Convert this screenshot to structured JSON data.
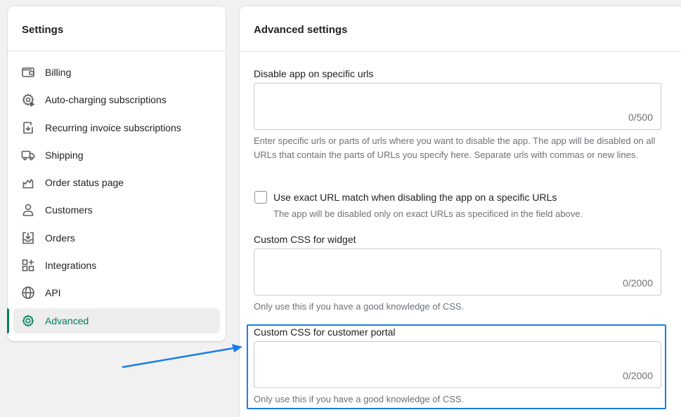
{
  "sidebar": {
    "title": "Settings",
    "items": [
      {
        "label": "Billing",
        "icon": "wallet-icon"
      },
      {
        "label": "Auto-charging subscriptions",
        "icon": "gear-play-icon"
      },
      {
        "label": "Recurring invoice subscriptions",
        "icon": "invoice-icon"
      },
      {
        "label": "Shipping",
        "icon": "truck-icon"
      },
      {
        "label": "Order status page",
        "icon": "order-status-icon"
      },
      {
        "label": "Customers",
        "icon": "person-icon"
      },
      {
        "label": "Orders",
        "icon": "inbox-download-icon"
      },
      {
        "label": "Integrations",
        "icon": "apps-icon"
      },
      {
        "label": "API",
        "icon": "globe-icon"
      },
      {
        "label": "Advanced",
        "icon": "gear-icon",
        "active": true
      }
    ]
  },
  "main": {
    "title": "Advanced settings",
    "disable_urls": {
      "label": "Disable app on specific urls",
      "value": "",
      "counter": "0/500",
      "help": "Enter specific urls or parts of urls where you want to disable the app. The app will be disabled on all URLs that contain the parts of URLs you specify here. Separate urls with commas or new lines."
    },
    "exact_match": {
      "label": "Use exact URL match when disabling the app on a specific URLs",
      "help": "The app will be disabled only on exact URLs as specificed in the field above.",
      "checked": false
    },
    "css_widget": {
      "label": "Custom CSS for widget",
      "value": "",
      "counter": "0/2000",
      "help": "Only use this if you have a good knowledge of CSS."
    },
    "css_portal": {
      "label": "Custom CSS for customer portal",
      "value": "",
      "counter": "0/2000",
      "help": "Only use this if you have a good knowledge of CSS."
    }
  },
  "colors": {
    "accent": "#007f5f",
    "annotation": "#1a7ce8"
  }
}
